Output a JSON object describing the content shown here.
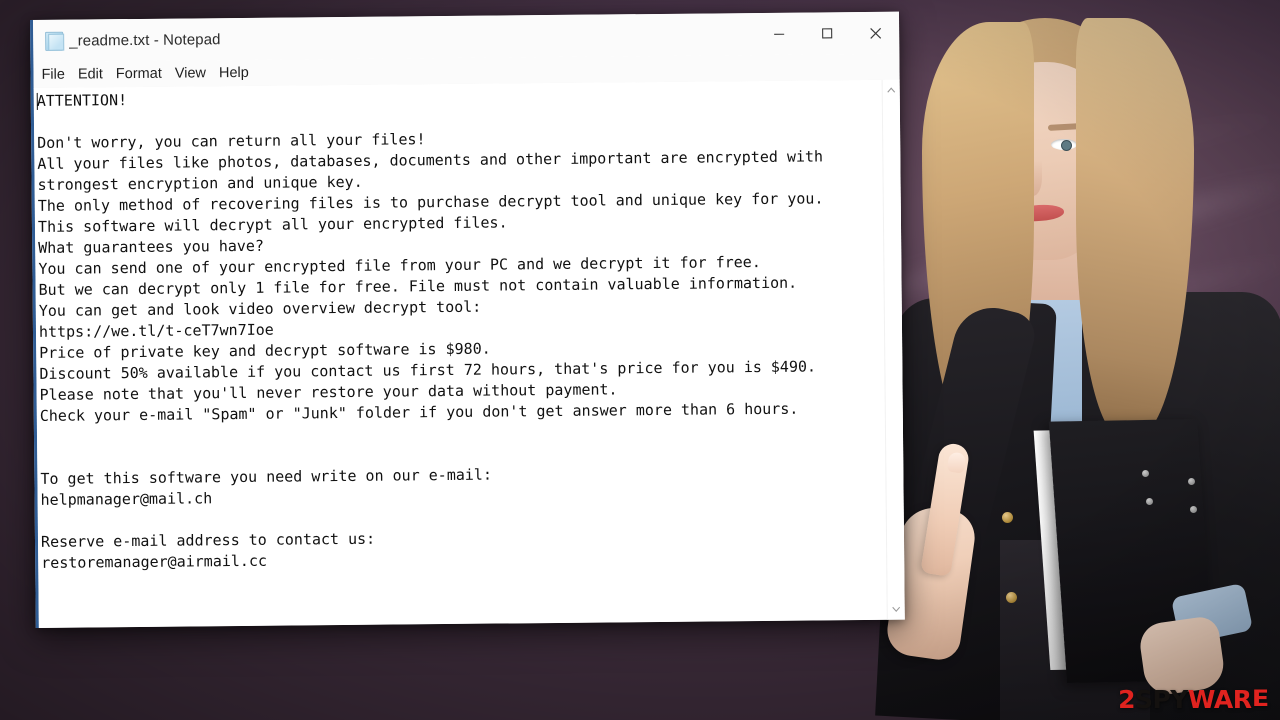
{
  "window": {
    "title": "_readme.txt - Notepad",
    "icon": "notepad-document-icon",
    "menu": [
      "File",
      "Edit",
      "Format",
      "View",
      "Help"
    ],
    "controls": {
      "minimize": "minimize-icon",
      "maximize": "maximize-icon",
      "close": "close-icon"
    }
  },
  "document": {
    "filename": "_readme.txt",
    "lines": [
      "ATTENTION!",
      "",
      "Don't worry, you can return all your files!",
      "All your files like photos, databases, documents and other important are encrypted with",
      "strongest encryption and unique key.",
      "The only method of recovering files is to purchase decrypt tool and unique key for you.",
      "This software will decrypt all your encrypted files.",
      "What guarantees you have?",
      "You can send one of your encrypted file from your PC and we decrypt it for free.",
      "But we can decrypt only 1 file for free. File must not contain valuable information.",
      "You can get and look video overview decrypt tool:",
      "https://we.tl/t-ceT7wn7Ioe",
      "Price of private key and decrypt software is $980.",
      "Discount 50% available if you contact us first 72 hours, that's price for you is $490.",
      "Please note that you'll never restore your data without payment.",
      "Check your e-mail \"Spam\" or \"Junk\" folder if you don't get answer more than 6 hours.",
      "",
      "",
      "To get this software you need write on our e-mail:",
      "helpmanager@mail.ch",
      "",
      "Reserve e-mail address to contact us:",
      "restoremanager@airmail.cc"
    ],
    "price": "$980",
    "discount_price": "$490",
    "discount_percent": "50%",
    "deadline_hours": "72",
    "response_hours": "6",
    "video_url": "https://we.tl/t-ceT7wn7Ioe",
    "primary_email": "helpmanager@mail.ch",
    "reserve_email": "restoremanager@airmail.cc"
  },
  "scrollbar": {
    "up_arrow": "chevron-up-icon",
    "down_arrow": "chevron-down-icon"
  },
  "watermark": {
    "part1": "2",
    "part2": "SPY",
    "part3": "WAR",
    "mark": "E"
  },
  "colors": {
    "background": "#3a2c38",
    "window_border_accent": "#2f5c94",
    "watermark_red": "#e0231f",
    "watermark_black": "#14110f"
  }
}
